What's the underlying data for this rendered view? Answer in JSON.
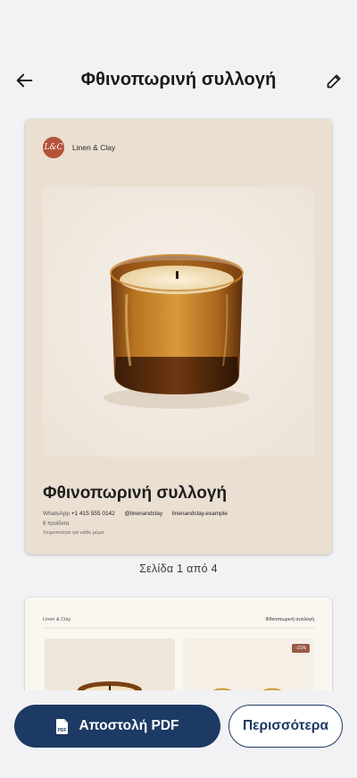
{
  "header": {
    "title": "Φθινοπωρινή συλλογή",
    "back_icon": "arrow-left-icon",
    "edit_icon": "pencil-icon"
  },
  "page1": {
    "brand": {
      "logo_text": "L&C",
      "name": "Linen & Clay",
      "logo_color": "#b5523b"
    },
    "hero_alt": "amber-candle-jar",
    "title": "Φθινοπωρινή συλλογή",
    "contacts": {
      "whatsapp_label": "WhatsApp",
      "whatsapp_number": "+1 415 555 0142",
      "instagram": "@linenandclay",
      "website": "linenandclay.example"
    },
    "product_count": "6 προϊόντα",
    "tagline": "Χειροποίητα για κάθε μέρα",
    "background": "#eadfd1"
  },
  "page_indicator": "Σελίδα 1 από 4",
  "page2": {
    "brand": "Linen & Clay",
    "title": "Φθινοπωρινή συλλογή",
    "discount_badge": "-21%"
  },
  "bottom": {
    "send_label": "Αποστολή PDF",
    "send_icon": "pdf-file-icon",
    "more_label": "Περισσότερα",
    "accent": "#1c3a63"
  }
}
